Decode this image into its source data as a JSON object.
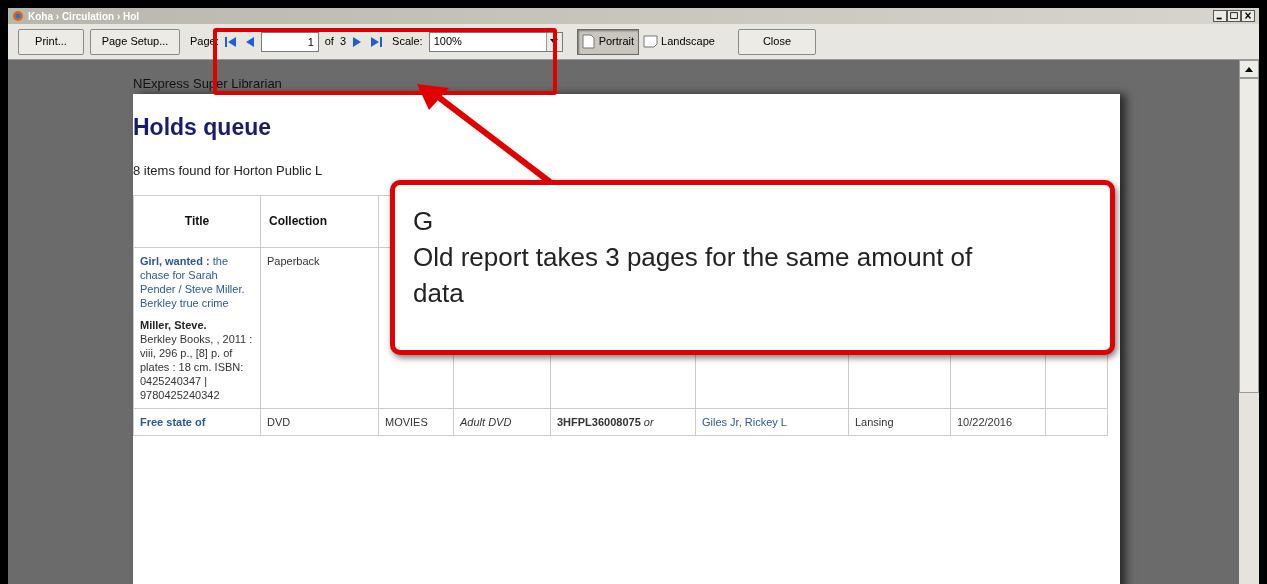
{
  "window": {
    "title": "Koha › Circulation › Hol"
  },
  "toolbar": {
    "print": "Print...",
    "page_setup": "Page Setup...",
    "page_label": "Page:",
    "page_value": "1",
    "of_label": "of",
    "page_count": "3",
    "scale_label": "Scale:",
    "scale_value": "100%",
    "orientations": [
      {
        "label": "Portrait",
        "selected": true
      },
      {
        "label": "Landscape",
        "selected": false
      }
    ],
    "close": "Close"
  },
  "page": {
    "header": "NExpress Super Librarian",
    "heading": "Holds queue",
    "summary": "8 items found for Horton Public L",
    "table": {
      "columns": [
        "Title",
        "Collection",
        "",
        "",
        "",
        "",
        "",
        "",
        ""
      ],
      "rows": [
        {
          "cells": [
            {
              "kind": "title",
              "text": "**Girl, wanted :** the chase for Sarah Pender / Steve Miller. Berkley true crime",
              "author": "Miller, Steve.",
              "details": "Berkley Books, , 2011 : viii, 296 p., [8] p. of plates : 18 cm. ISBN: 0425240347 | 9780425240342"
            },
            {
              "kind": "plain",
              "text": "Paperback"
            }
          ]
        },
        {
          "cells": [
            {
              "kind": "title",
              "text": "**Free state of**"
            },
            {
              "kind": "plain",
              "text": "DVD"
            },
            {
              "kind": "plain",
              "text": "MOVIES"
            },
            {
              "kind": "italic",
              "text": "Adult DVD"
            },
            {
              "kind": "plain",
              "text": "**3HFPL36008075** *or*"
            },
            {
              "kind": "link",
              "text": "Giles Jr, Rickey L"
            },
            {
              "kind": "plain",
              "text": "Lansing"
            },
            {
              "kind": "plain",
              "text": "10/22/2016"
            }
          ]
        }
      ]
    }
  },
  "callout": {
    "lines": [
      "G",
      "Old report takes 3 pages for the same amount of data"
    ]
  }
}
